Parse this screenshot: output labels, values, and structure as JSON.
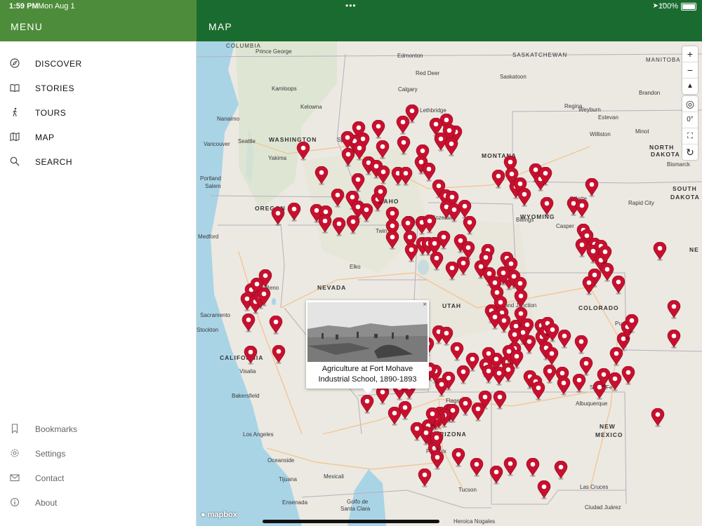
{
  "status_bar": {
    "time": "1:59 PM",
    "date": "Mon Aug 1",
    "battery": "100%",
    "dots": "•••"
  },
  "sidebar": {
    "title": "MENU",
    "items": [
      {
        "label": "DISCOVER",
        "icon": "compass-icon"
      },
      {
        "label": "STORIES",
        "icon": "book-icon"
      },
      {
        "label": "TOURS",
        "icon": "walking-icon"
      },
      {
        "label": "MAP",
        "icon": "map-icon"
      },
      {
        "label": "SEARCH",
        "icon": "search-icon"
      }
    ],
    "bottom_items": [
      {
        "label": "Bookmarks",
        "icon": "bookmark-icon"
      },
      {
        "label": "Settings",
        "icon": "gear-icon"
      },
      {
        "label": "Contact",
        "icon": "mail-icon"
      },
      {
        "label": "About",
        "icon": "info-icon"
      }
    ]
  },
  "map_header": {
    "title": "MAP"
  },
  "map": {
    "controls": {
      "zoom_in": "+",
      "zoom_out": "−",
      "compass": "▲",
      "locate": "◎",
      "bearing": "0°",
      "fullscreen": "⛶",
      "refresh": "↻"
    },
    "labels": [
      {
        "text": "COLUMBIA",
        "cls": "country"
      },
      {
        "text": "SASKATCHEWAN",
        "cls": "country"
      },
      {
        "text": "MANITOBA",
        "cls": "country"
      },
      {
        "text": "Edmonton",
        "cls": "city"
      },
      {
        "text": "Prince George",
        "cls": "city"
      },
      {
        "text": "Red Deer",
        "cls": "city"
      },
      {
        "text": "Saskatoon",
        "cls": "city"
      },
      {
        "text": "Calgary",
        "cls": "city"
      },
      {
        "text": "Regina",
        "cls": "city"
      },
      {
        "text": "Brandon",
        "cls": "city"
      },
      {
        "text": "Kamloops",
        "cls": "city"
      },
      {
        "text": "Kelowna",
        "cls": "city"
      },
      {
        "text": "Lethbridge",
        "cls": "city"
      },
      {
        "text": "Weyburn",
        "cls": "city"
      },
      {
        "text": "Estevan",
        "cls": "city"
      },
      {
        "text": "Nanaimo",
        "cls": "city"
      },
      {
        "text": "Vancouver",
        "cls": "city"
      },
      {
        "text": "WASHINGTON",
        "cls": "state"
      },
      {
        "text": "Seattle",
        "cls": "city"
      },
      {
        "text": "Spokane",
        "cls": "city"
      },
      {
        "text": "Yakima",
        "cls": "city"
      },
      {
        "text": "MONTANA",
        "cls": "state"
      },
      {
        "text": "Williston",
        "cls": "city"
      },
      {
        "text": "Minot",
        "cls": "city"
      },
      {
        "text": "NORTH",
        "cls": "state"
      },
      {
        "text": "DAKOTA",
        "cls": "state"
      },
      {
        "text": "Bismarck",
        "cls": "city"
      },
      {
        "text": "Portland",
        "cls": "city"
      },
      {
        "text": "Salem",
        "cls": "city"
      },
      {
        "text": "OREGON",
        "cls": "state"
      },
      {
        "text": "IDAHO",
        "cls": "state"
      },
      {
        "text": "Bozeman",
        "cls": "city"
      },
      {
        "text": "Billings",
        "cls": "city"
      },
      {
        "text": "Gillette",
        "cls": "city"
      },
      {
        "text": "Rapid City",
        "cls": "city"
      },
      {
        "text": "SOUTH",
        "cls": "state"
      },
      {
        "text": "DAKOTA",
        "cls": "state"
      },
      {
        "text": "Medford",
        "cls": "city"
      },
      {
        "text": "Twin",
        "cls": "city"
      },
      {
        "text": "WYOMING",
        "cls": "state"
      },
      {
        "text": "Casper",
        "cls": "city"
      },
      {
        "text": "NEVADA",
        "cls": "state"
      },
      {
        "text": "Elko",
        "cls": "city"
      },
      {
        "text": "Reno",
        "cls": "city"
      },
      {
        "text": "Sacramento",
        "cls": "city"
      },
      {
        "text": "Stockton",
        "cls": "city"
      },
      {
        "text": "UTAH",
        "cls": "state"
      },
      {
        "text": "Grand Junction",
        "cls": "city"
      },
      {
        "text": "COLORADO",
        "cls": "state"
      },
      {
        "text": "Pueblo",
        "cls": "city"
      },
      {
        "text": "CALIFORNIA",
        "cls": "state"
      },
      {
        "text": "Visalia",
        "cls": "city"
      },
      {
        "text": "Bakersfield",
        "cls": "city"
      },
      {
        "text": "Santa Fe",
        "cls": "city"
      },
      {
        "text": "Albuquerque",
        "cls": "city"
      },
      {
        "text": "Flagstaff",
        "cls": "city"
      },
      {
        "text": "ARIZONA",
        "cls": "state"
      },
      {
        "text": "NEW",
        "cls": "state"
      },
      {
        "text": "MEXICO",
        "cls": "state"
      },
      {
        "text": "Los Angeles",
        "cls": "city"
      },
      {
        "text": "Phoenix",
        "cls": "city"
      },
      {
        "text": "Oceanside",
        "cls": "city"
      },
      {
        "text": "Tijuana",
        "cls": "city"
      },
      {
        "text": "Mexicali",
        "cls": "city"
      },
      {
        "text": "Tucson",
        "cls": "city"
      },
      {
        "text": "Las Cruces",
        "cls": "city"
      },
      {
        "text": "Ensenada",
        "cls": "city"
      },
      {
        "text": "Golfo de",
        "cls": "city"
      },
      {
        "text": "Santa Clara",
        "cls": "city"
      },
      {
        "text": "Ciudad Juárez",
        "cls": "city"
      },
      {
        "text": "Heroica Nogales",
        "cls": "city"
      },
      {
        "text": "NE",
        "cls": "state"
      }
    ],
    "popup": {
      "caption": "Agriculture at Fort Mohave Industrial School, 1890-1893",
      "close": "×"
    },
    "attribution": "mapbox",
    "marker_color": "#c8102e"
  }
}
